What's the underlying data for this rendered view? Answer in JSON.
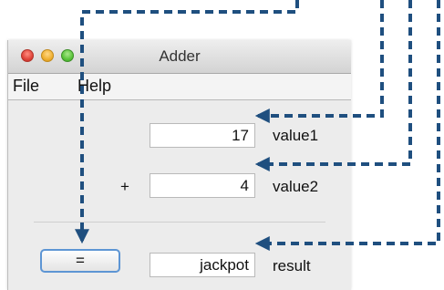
{
  "window": {
    "title": "Adder",
    "menu": {
      "file_label": "File",
      "help_label": "Help"
    }
  },
  "form": {
    "value1": {
      "value": "17",
      "label": "value1"
    },
    "value2": {
      "value": "4",
      "label": "value2",
      "operator": "+"
    },
    "result": {
      "value": "jackpot",
      "label": "result"
    },
    "equals_button_label": "="
  },
  "colors": {
    "arrow": "#1f4f7f",
    "button_focus_ring": "#5d95d4",
    "close": "#e0443a",
    "minimize": "#f0b030",
    "zoom": "#5ac43a"
  }
}
